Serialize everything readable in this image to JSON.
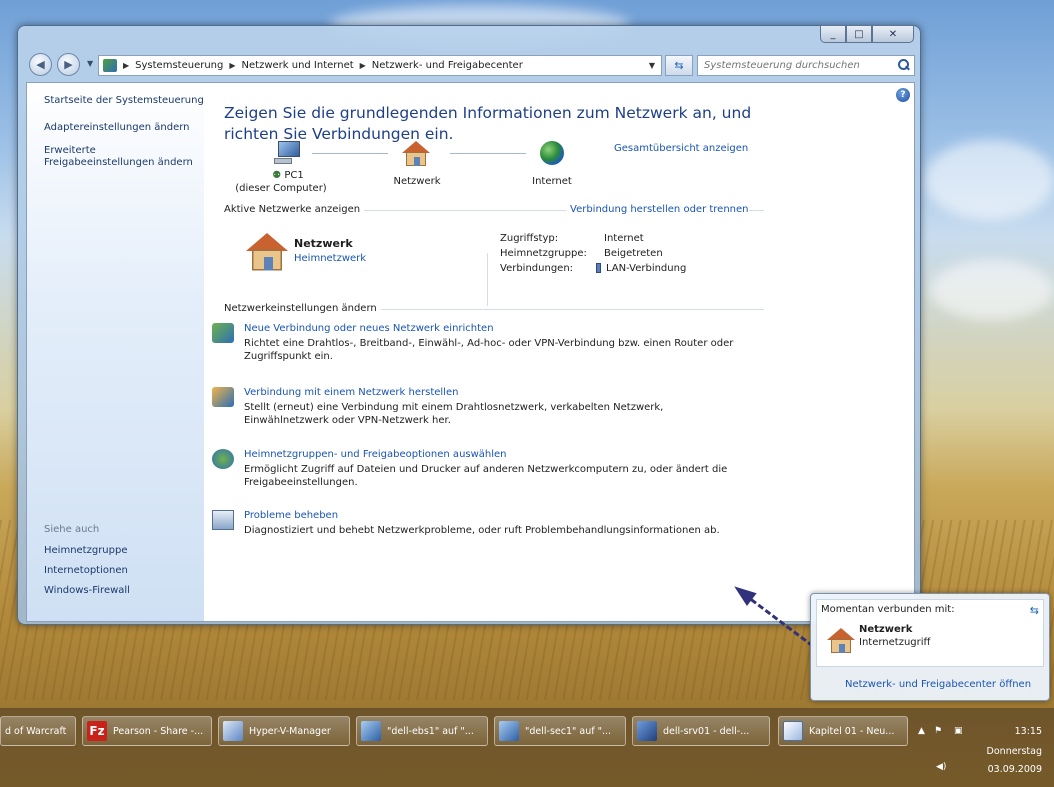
{
  "window": {
    "caption_buttons": {
      "minimize": "_",
      "maximize": "□",
      "close": "✕"
    },
    "addressbar": {
      "crumbs": [
        "Systemsteuerung",
        "Netzwerk und Internet",
        "Netzwerk- und Freigabecenter"
      ]
    },
    "search": {
      "placeholder": "Systemsteuerung durchsuchen"
    }
  },
  "sidebar": {
    "items": [
      {
        "label": "Startseite der Systemsteuerung"
      },
      {
        "label": "Adaptereinstellungen ändern"
      },
      {
        "label": "Erweiterte Freigabeeinstellungen ändern"
      }
    ],
    "see_also_heading": "Siehe auch",
    "see_also": [
      {
        "label": "Heimnetzgruppe"
      },
      {
        "label": "Internetoptionen"
      },
      {
        "label": "Windows-Firewall"
      }
    ]
  },
  "main": {
    "title": "Zeigen Sie die grundlegenden Informationen zum Netzwerk an, und richten Sie Verbindungen ein.",
    "full_map_link": "Gesamtübersicht anzeigen",
    "map": {
      "pc_name": "PC1",
      "pc_sub": "(dieser Computer)",
      "network": "Netzwerk",
      "internet": "Internet"
    },
    "active_networks": {
      "heading": "Aktive Netzwerke anzeigen",
      "connect_link": "Verbindung herstellen oder trennen",
      "network_name": "Netzwerk",
      "network_type": "Heimnetzwerk",
      "access_type_label": "Zugriffstyp:",
      "access_type_value": "Internet",
      "homegroup_label": "Heimnetzgruppe:",
      "homegroup_value": "Beigetreten",
      "connections_label": "Verbindungen:",
      "connections_value": "LAN-Verbindung"
    },
    "change_settings": {
      "heading": "Netzwerkeinstellungen ändern",
      "tasks": [
        {
          "link": "Neue Verbindung oder neues Netzwerk einrichten",
          "desc": "Richtet eine Drahtlos-, Breitband-, Einwähl-, Ad-hoc- oder VPN-Verbindung bzw. einen Router oder Zugriffspunkt ein.",
          "icon": "new-connection-icon"
        },
        {
          "link": "Verbindung mit einem Netzwerk herstellen",
          "desc": "Stellt (erneut) eine Verbindung mit einem Drahtlosnetzwerk, verkabelten Netzwerk, Einwählnetzwerk oder VPN-Netzwerk her.",
          "icon": "connect-network-icon"
        },
        {
          "link": "Heimnetzgruppen- und Freigabeoptionen auswählen",
          "desc": "Ermöglicht Zugriff auf Dateien und Drucker auf anderen Netzwerkcomputern zu, oder ändert die Freigabeeinstellungen.",
          "icon": "homegroup-icon"
        },
        {
          "link": "Probleme beheben",
          "desc": "Diagnostiziert und behebt Netzwerkprobleme, oder ruft Problembehandlungsinformationen ab.",
          "icon": "troubleshoot-icon"
        }
      ]
    }
  },
  "popup": {
    "title": "Momentan verbunden mit:",
    "network_name": "Netzwerk",
    "network_access": "Internetzugriff",
    "link": "Netzwerk- und Freigabecenter öffnen"
  },
  "taskbar": {
    "buttons": [
      {
        "label": "d of Warcraft"
      },
      {
        "label": "Pearson - Share -..."
      },
      {
        "label": "Hyper-V-Manager"
      },
      {
        "label": "\"dell-ebs1\" auf \"..."
      },
      {
        "label": "\"dell-sec1\" auf \"..."
      },
      {
        "label": "dell-srv01 - dell-..."
      },
      {
        "label": "Kapitel 01 - Neu..."
      }
    ],
    "clock": {
      "time": "13:15",
      "day": "Donnerstag",
      "date": "03.09.2009"
    }
  },
  "colors": {
    "link": "#1a55b3",
    "title": "#1e3f8a",
    "arrow": "#31317c"
  }
}
